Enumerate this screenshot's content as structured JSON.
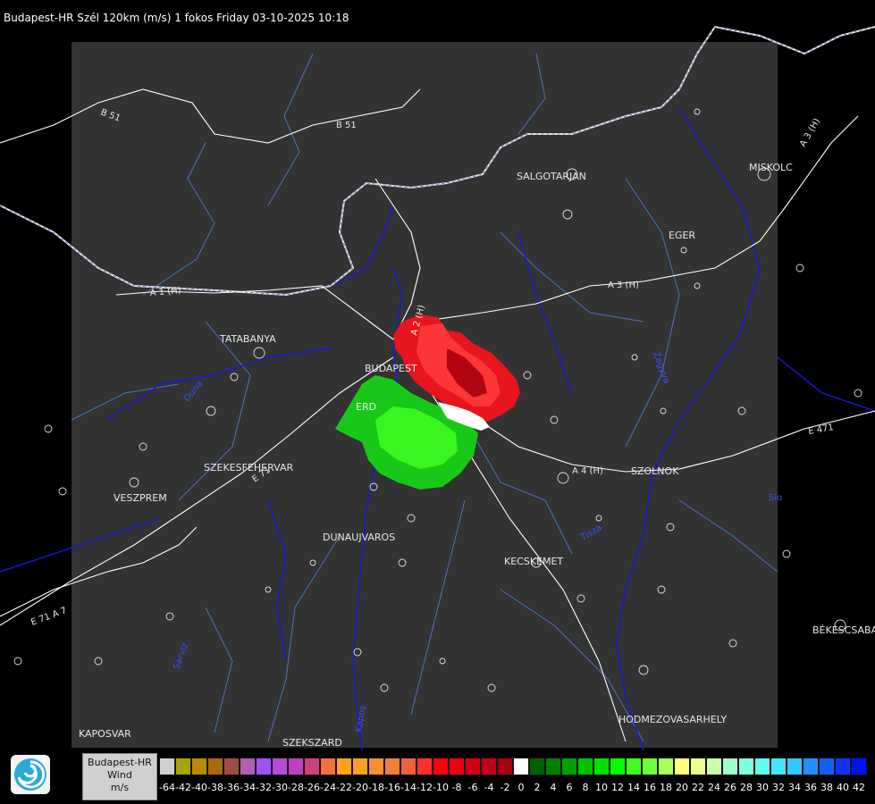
{
  "header": {
    "title": "Budapest-HR Szél 120km (m/s) 1 fokos Friday 03-10-2025 10:18"
  },
  "cities": [
    {
      "id": "budapest",
      "label": "BUDAPEST"
    },
    {
      "id": "tatabanya",
      "label": "TATABANYA"
    },
    {
      "id": "szekesfehervar",
      "label": "SZEKESFEHERVAR"
    },
    {
      "id": "veszprem",
      "label": "VESZPREM"
    },
    {
      "id": "dunaujvaros",
      "label": "DUNAUJVAROS"
    },
    {
      "id": "kecskemet",
      "label": "KECSKEMET"
    },
    {
      "id": "szolnok",
      "label": "SZOLNOK"
    },
    {
      "id": "eger",
      "label": "EGER"
    },
    {
      "id": "salgotarjan",
      "label": "SALGOTARJAN"
    },
    {
      "id": "miskolc",
      "label": "MISKOLC"
    },
    {
      "id": "bekescsaba",
      "label": "BÉKESCSABA"
    },
    {
      "id": "hodmezovasarhely",
      "label": "HODMEZOVASARHELY"
    },
    {
      "id": "kaposvar",
      "label": "KAPOSVAR"
    },
    {
      "id": "szekszard",
      "label": "SZEKSZARD"
    },
    {
      "id": "erd",
      "label": "ERD"
    }
  ],
  "roads": [
    {
      "id": "b51-west",
      "label": "B 51"
    },
    {
      "id": "b51-north",
      "label": "B 51"
    },
    {
      "id": "a1",
      "label": "A 1 (H)"
    },
    {
      "id": "a2",
      "label": "A 2 (H)"
    },
    {
      "id": "a3",
      "label": "A 3 (H)"
    },
    {
      "id": "a3-ne",
      "label": "A 3 (H)"
    },
    {
      "id": "a4",
      "label": "A 4 (H)"
    },
    {
      "id": "e71",
      "label": "E 71"
    },
    {
      "id": "e71-sw",
      "label": "E 71 A 7"
    },
    {
      "id": "e471",
      "label": "E 471"
    }
  ],
  "rivers": [
    {
      "id": "duna",
      "label": "Duna"
    },
    {
      "id": "tisza",
      "label": "Tisza"
    },
    {
      "id": "sarviz",
      "label": "Sarviz"
    },
    {
      "id": "zagyva",
      "label": "Zagyva"
    },
    {
      "id": "kapos",
      "label": "Kapos"
    },
    {
      "id": "sio",
      "label": "Sio"
    }
  ],
  "legend": {
    "station": "Budapest-HR",
    "quantity": "Wind",
    "unit": "m/s",
    "ticks": [
      "-64",
      "-42",
      "-40",
      "-38",
      "-36",
      "-34",
      "-32",
      "-30",
      "-28",
      "-26",
      "-24",
      "-22",
      "-20",
      "-18",
      "-16",
      "-14",
      "-12",
      "-10",
      "-8",
      "-6",
      "-4",
      "-2",
      "0",
      "2",
      "4",
      "6",
      "8",
      "10",
      "12",
      "14",
      "16",
      "18",
      "20",
      "22",
      "24",
      "26",
      "28",
      "30",
      "32",
      "34",
      "36",
      "38",
      "40",
      "42"
    ],
    "colors": [
      "#d0d0d0",
      "#a8a400",
      "#b88a08",
      "#a86a10",
      "#a04a4a",
      "#b060b0",
      "#a050ff",
      "#b84cd8",
      "#c040c0",
      "#d04080",
      "#f07040",
      "#ffa020",
      "#f8a020",
      "#f49030",
      "#f08040",
      "#f06040",
      "#ff3030",
      "#ff0010",
      "#e80018",
      "#d00018",
      "#c00018",
      "#a80010",
      "#ffffff",
      "#006000",
      "#008000",
      "#00a000",
      "#00c000",
      "#00e000",
      "#00ff00",
      "#40ff20",
      "#70ff40",
      "#a8ff60",
      "#ffff80",
      "#e8ff90",
      "#c8ffa8",
      "#a0ffc8",
      "#80ffe0",
      "#60fff0",
      "#40e8ff",
      "#30c8ff",
      "#2090ff",
      "#1060ff",
      "#1030ff",
      "#0010ff"
    ]
  }
}
